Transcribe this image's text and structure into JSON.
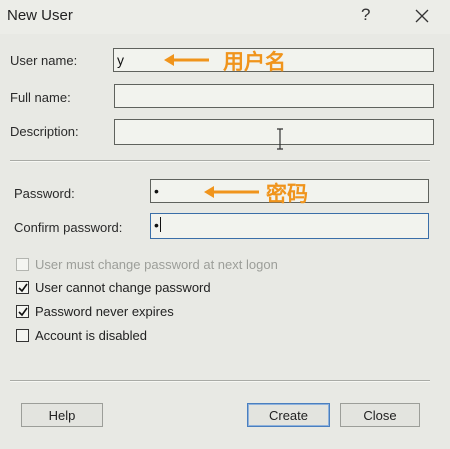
{
  "window": {
    "title": "New User",
    "help_glyph": "?",
    "close_icon": "close-icon"
  },
  "fields": {
    "user_name": {
      "label": "User name:",
      "value": "y"
    },
    "full_name": {
      "label": "Full name:",
      "value": ""
    },
    "description": {
      "label": "Description:",
      "value": ""
    },
    "password": {
      "label": "Password:",
      "value": "•"
    },
    "confirm_password": {
      "label": "Confirm password:",
      "value": "•"
    }
  },
  "annotations": {
    "username_note": "用户名",
    "password_note": "密码",
    "color": "#f0941c"
  },
  "checkboxes": [
    {
      "label": "User must change password at next logon",
      "checked": false,
      "enabled": false
    },
    {
      "label": "User cannot change password",
      "checked": true,
      "enabled": true
    },
    {
      "label": "Password never expires",
      "checked": true,
      "enabled": true
    },
    {
      "label": "Account is disabled",
      "checked": false,
      "enabled": true
    }
  ],
  "buttons": {
    "help": "Help",
    "create": "Create",
    "close": "Close"
  }
}
